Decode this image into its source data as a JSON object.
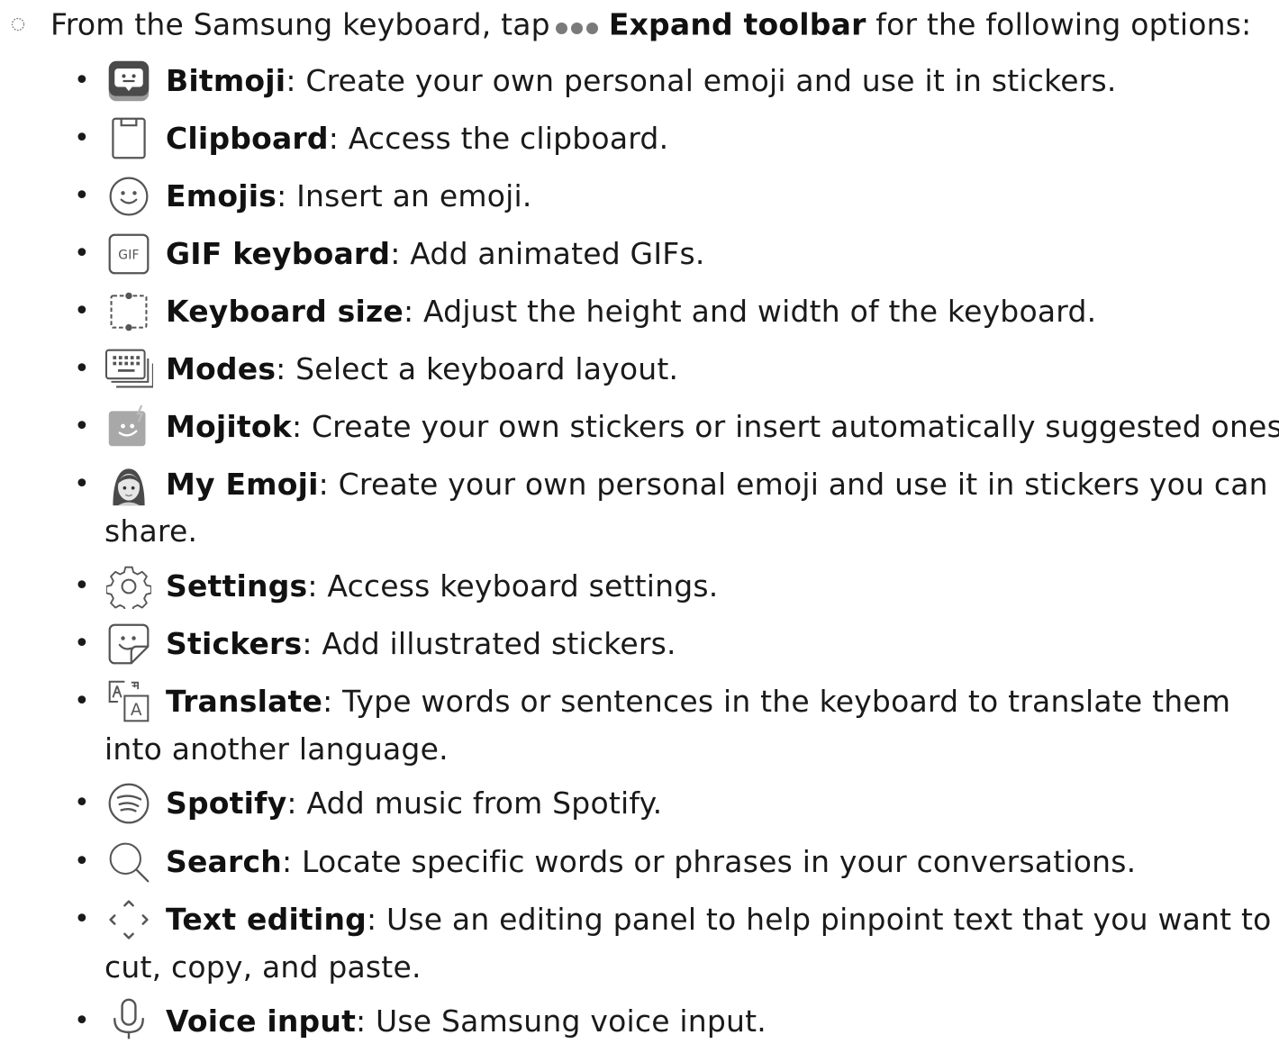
{
  "intro": {
    "prefix": "From the Samsung keyboard, tap",
    "bold": "Expand toolbar",
    "suffix": "for the following options:",
    "icon": "dots-icon"
  },
  "items": [
    {
      "icon": "bitmoji-icon",
      "name": "Bitmoji",
      "desc": ": Create your own personal emoji and use it in stickers."
    },
    {
      "icon": "clipboard-icon",
      "name": "Clipboard",
      "desc": ": Access the clipboard."
    },
    {
      "icon": "emoji-icon",
      "name": "Emojis",
      "desc": ": Insert an emoji."
    },
    {
      "icon": "gif-icon",
      "name": "GIF keyboard",
      "desc": ": Add animated GIFs.",
      "icon_text": "GIF"
    },
    {
      "icon": "keyboard-size-icon",
      "name": "Keyboard size",
      "desc": ": Adjust the height and width of the keyboard."
    },
    {
      "icon": "modes-icon",
      "name": "Modes",
      "desc": ": Select a keyboard layout."
    },
    {
      "icon": "mojitok-icon",
      "name": "Mojitok",
      "desc": ": Create your own stickers or insert automatically suggested ones."
    },
    {
      "icon": "my-emoji-icon",
      "name": "My Emoji",
      "desc": ": Create your own personal emoji and use it in stickers you can",
      "cont": "share."
    },
    {
      "icon": "settings-icon",
      "name": "Settings",
      "desc": ": Access keyboard settings."
    },
    {
      "icon": "stickers-icon",
      "name": "Stickers",
      "desc": ": Add illustrated stickers."
    },
    {
      "icon": "translate-icon",
      "name": "Translate",
      "desc": ": Type words or sentences in the keyboard to translate them",
      "cont": "into another language.",
      "icon_text": "A"
    },
    {
      "icon": "spotify-icon",
      "name": "Spotify",
      "desc": ": Add music from Spotify."
    },
    {
      "icon": "search-icon",
      "name": "Search",
      "desc": ": Locate specific words or phrases in your conversations."
    },
    {
      "icon": "text-editing-icon",
      "name": "Text editing",
      "desc": ": Use an editing panel to help pinpoint text that you want to",
      "cont": "cut, copy, and paste."
    },
    {
      "icon": "voice-input-icon",
      "name": "Voice input",
      "desc": ": Use Samsung voice input."
    }
  ]
}
